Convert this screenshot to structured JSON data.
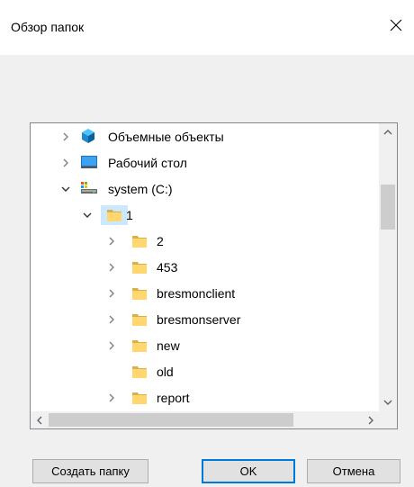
{
  "window": {
    "title": "Обзор папок"
  },
  "tree": {
    "items": [
      {
        "label": "Объемные объекты",
        "icon": "3d-objects-icon",
        "expander": "collapsed"
      },
      {
        "label": "Рабочий стол",
        "icon": "desktop-icon",
        "expander": "collapsed"
      },
      {
        "label": "system (C:)",
        "icon": "drive-icon",
        "expander": "expanded"
      },
      {
        "label": "1",
        "icon": "folder-icon",
        "expander": "expanded",
        "selected": true
      },
      {
        "label": "2",
        "icon": "folder-icon",
        "expander": "collapsed"
      },
      {
        "label": "453",
        "icon": "folder-icon",
        "expander": "collapsed"
      },
      {
        "label": "bresmonclient",
        "icon": "folder-icon",
        "expander": "collapsed"
      },
      {
        "label": "bresmonserver",
        "icon": "folder-icon",
        "expander": "collapsed"
      },
      {
        "label": "new",
        "icon": "folder-icon",
        "expander": "collapsed"
      },
      {
        "label": "old",
        "icon": "folder-icon",
        "expander": "none"
      },
      {
        "label": "report",
        "icon": "folder-icon",
        "expander": "collapsed"
      }
    ]
  },
  "buttons": {
    "new_folder": "Создать папку",
    "ok": "OK",
    "cancel": "Отмена"
  },
  "colors": {
    "selection": "#cce8ff",
    "folder": "#ffd76e",
    "accent": "#0078d7"
  }
}
